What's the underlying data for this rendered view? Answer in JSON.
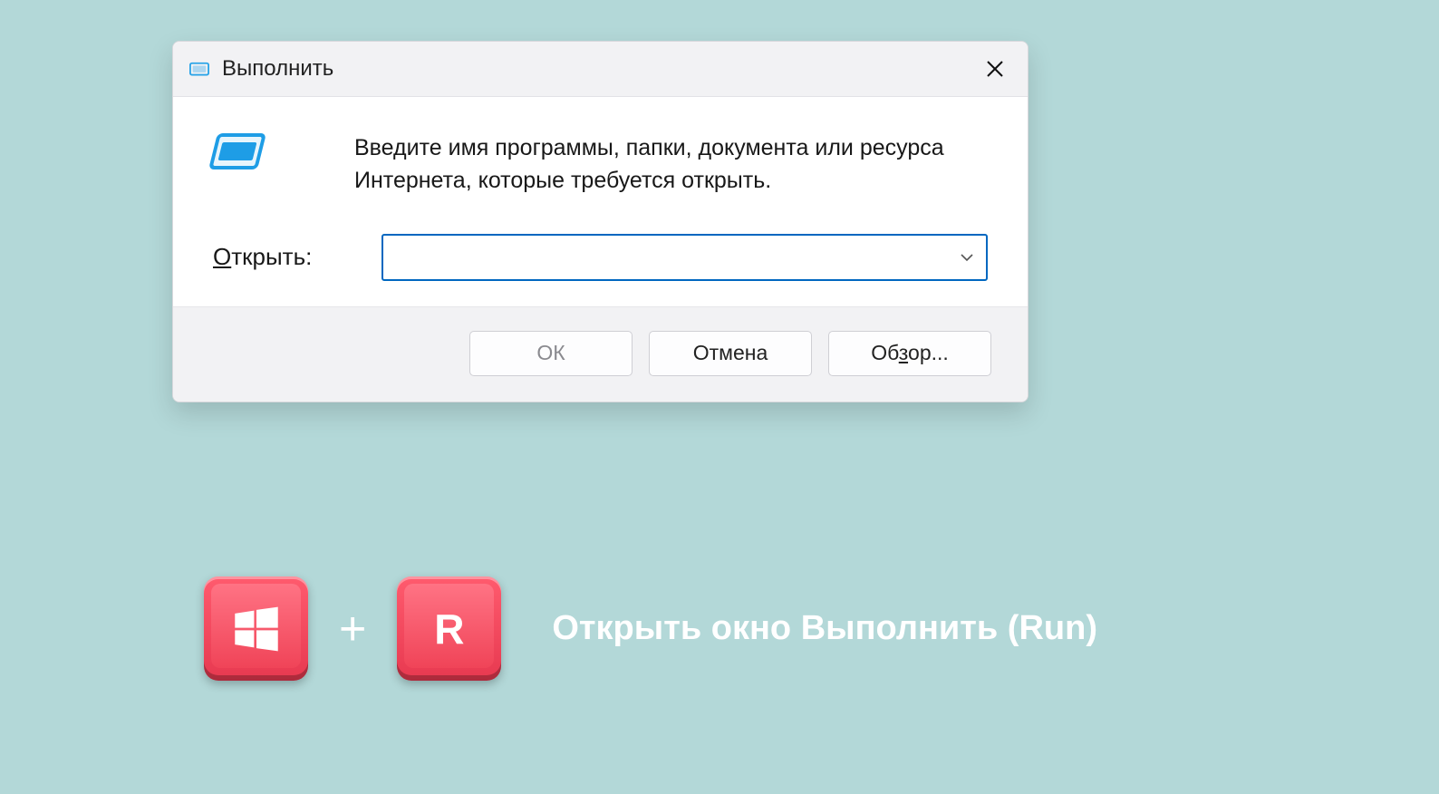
{
  "dialog": {
    "title": "Выполнить",
    "description": "Введите имя программы, папки, документа или ресурса Интернета, которые требуется открыть.",
    "open_label_prefix_ul": "О",
    "open_label_rest": "ткрыть:",
    "input_value": "",
    "buttons": {
      "ok": "ОК",
      "cancel": "Отмена",
      "browse_prefix": "Об",
      "browse_ul": "з",
      "browse_suffix": "ор..."
    }
  },
  "shortcut": {
    "plus": "+",
    "key_r": "R",
    "caption": "Открыть окно Выполнить (Run)"
  }
}
